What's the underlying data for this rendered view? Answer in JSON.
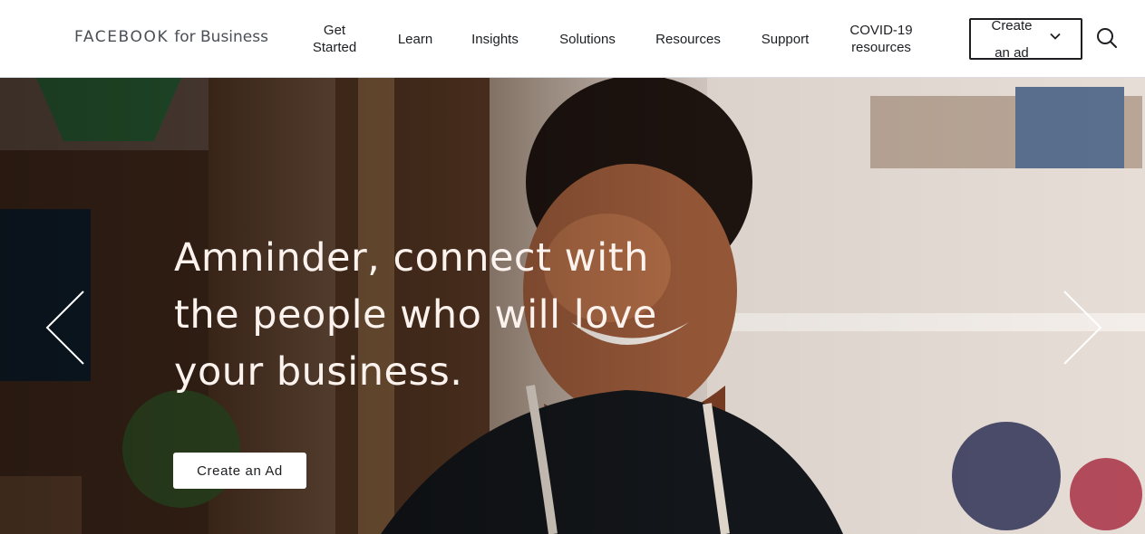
{
  "header": {
    "logo_brand": "FACEBOOK",
    "logo_suffix": "for Business",
    "nav": {
      "get_started_l1": "Get",
      "get_started_l2": "Started",
      "learn": "Learn",
      "insights": "Insights",
      "solutions": "Solutions",
      "resources": "Resources",
      "support": "Support",
      "covid_l1": "COVID-19",
      "covid_l2": "resources"
    },
    "create_ad_dropdown": {
      "line1": "Create",
      "line2": "an ad",
      "icon": "chevron-down-icon"
    },
    "search_icon": "search-icon"
  },
  "hero": {
    "headline_lines": [
      "Amninder, connect with",
      "the people who will love",
      "your business."
    ],
    "cta_label": "Create an Ad",
    "prev_icon": "chevron-left-icon",
    "next_icon": "chevron-right-icon"
  },
  "colors": {
    "header_bg": "#ffffff",
    "text": "#1c1e21",
    "headline_text": "#fdf3ee",
    "button_bg": "#ffffff"
  }
}
